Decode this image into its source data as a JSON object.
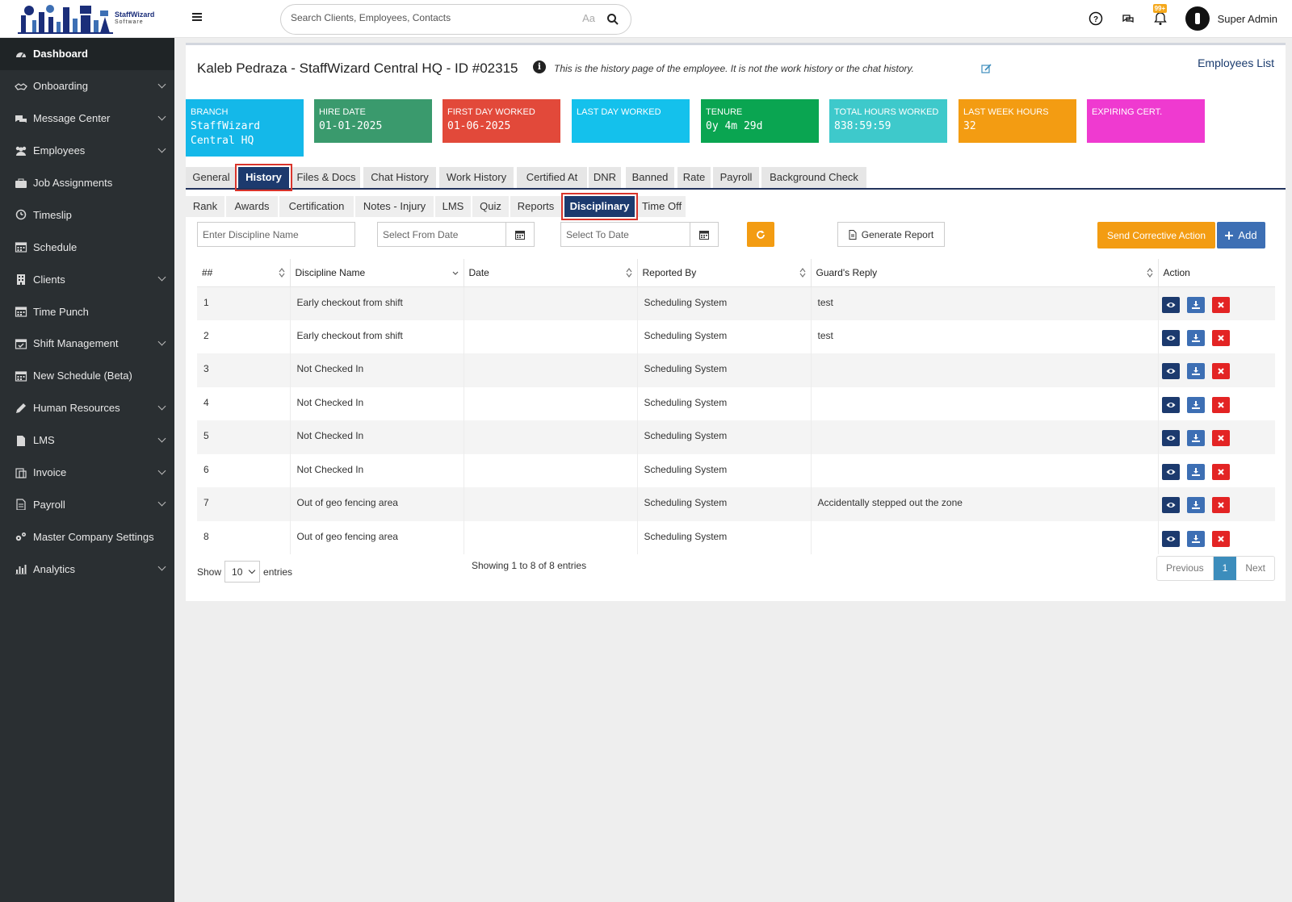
{
  "app": {
    "logo_text": "StaffWizard",
    "logo_sub": "Software",
    "search_placeholder": "Search Clients, Employees, Contacts",
    "search_aa": "Aa",
    "notification_badge": "99+",
    "username": "Super Admin"
  },
  "sidebar": {
    "items": [
      {
        "label": "Dashboard",
        "icon": "dashboard-icon",
        "has_submenu": false
      },
      {
        "label": "Onboarding",
        "icon": "handshake-icon",
        "has_submenu": true
      },
      {
        "label": "Message Center",
        "icon": "chat-icon",
        "has_submenu": true
      },
      {
        "label": "Employees",
        "icon": "users-icon",
        "has_submenu": true
      },
      {
        "label": "Job Assignments",
        "icon": "briefcase-icon",
        "has_submenu": false
      },
      {
        "label": "Timeslip",
        "icon": "clock-icon",
        "has_submenu": false
      },
      {
        "label": "Schedule",
        "icon": "calendar-icon",
        "has_submenu": false
      },
      {
        "label": "Clients",
        "icon": "building-icon",
        "has_submenu": true
      },
      {
        "label": "Time Punch",
        "icon": "calendar-icon",
        "has_submenu": false
      },
      {
        "label": "Shift Management",
        "icon": "calendar-check-icon",
        "has_submenu": true
      },
      {
        "label": "New Schedule (Beta)",
        "icon": "calendar-icon",
        "has_submenu": false
      },
      {
        "label": "Human Resources",
        "icon": "pencil-icon",
        "has_submenu": true
      },
      {
        "label": "LMS",
        "icon": "file-icon",
        "has_submenu": true
      },
      {
        "label": "Invoice",
        "icon": "invoice-icon",
        "has_submenu": true
      },
      {
        "label": "Payroll",
        "icon": "document-icon",
        "has_submenu": true
      },
      {
        "label": "Master Company Settings",
        "icon": "gears-icon",
        "has_submenu": false
      },
      {
        "label": "Analytics",
        "icon": "bar-chart-icon",
        "has_submenu": true
      }
    ]
  },
  "header": {
    "title": "Kaleb Pedraza - StaffWizard Central HQ - ID #02315",
    "info_text": "This is the history page of the employee. It is not the work history or the chat history.",
    "employees_list_link": "Employees List"
  },
  "cards": [
    {
      "label": "BRANCH",
      "value": "StaffWizard Central HQ",
      "color": "#14b8e9"
    },
    {
      "label": "HIRE DATE",
      "value": "01-01-2025",
      "color": "#3a9a6d"
    },
    {
      "label": "FIRST DAY WORKED",
      "value": "01-06-2025",
      "color": "#e2493a"
    },
    {
      "label": "LAST DAY WORKED",
      "value": "",
      "color": "#14c1ec"
    },
    {
      "label": "TENURE",
      "value": "0y 4m 29d",
      "color": "#0aa551"
    },
    {
      "label": "TOTAL HOURS WORKED",
      "value": "838:59:59",
      "color": "#3ec9cb"
    },
    {
      "label": "LAST WEEK HOURS",
      "value": "32",
      "color": "#f39c12"
    },
    {
      "label": "EXPIRING CERT.",
      "value": "",
      "color": "#ef3ad0"
    }
  ],
  "tabs": [
    "General",
    "History",
    "Files & Docs",
    "Chat History",
    "Work History",
    "Certified At",
    "DNR",
    "Banned",
    "Rate",
    "Payroll",
    "Background Check"
  ],
  "active_tab": "History",
  "subtabs": [
    "Rank",
    "Awards",
    "Certification",
    "Notes - Injury",
    "LMS",
    "Quiz",
    "Reports",
    "Disciplinary",
    "Time Off"
  ],
  "active_subtab": "Disciplinary",
  "filters": {
    "discipline_placeholder": "Enter Discipline Name",
    "from_date_placeholder": "Select From Date",
    "to_date_placeholder": "Select To Date",
    "generate_report": "Generate Report",
    "send_corrective": "Send Corrective Action",
    "add": "Add"
  },
  "table": {
    "columns": [
      "##",
      "Discipline Name",
      "Date",
      "Reported By",
      "Guard's Reply",
      "Action"
    ],
    "rows": [
      {
        "num": "1",
        "name": "Early checkout from shift",
        "date": "",
        "reported_by": "Scheduling System",
        "reply": "test"
      },
      {
        "num": "2",
        "name": "Early checkout from shift",
        "date": "",
        "reported_by": "Scheduling System",
        "reply": "test"
      },
      {
        "num": "3",
        "name": "Not Checked In",
        "date": "",
        "reported_by": "Scheduling System",
        "reply": ""
      },
      {
        "num": "4",
        "name": "Not Checked In",
        "date": "",
        "reported_by": "Scheduling System",
        "reply": ""
      },
      {
        "num": "5",
        "name": "Not Checked In",
        "date": "",
        "reported_by": "Scheduling System",
        "reply": ""
      },
      {
        "num": "6",
        "name": "Not Checked In",
        "date": "",
        "reported_by": "Scheduling System",
        "reply": ""
      },
      {
        "num": "7",
        "name": "Out of geo fencing area",
        "date": "",
        "reported_by": "Scheduling System",
        "reply": "Accidentally stepped out the zone"
      },
      {
        "num": "8",
        "name": "Out of geo fencing area",
        "date": "",
        "reported_by": "Scheduling System",
        "reply": ""
      }
    ]
  },
  "pagination": {
    "show_label": "Show",
    "page_size": "10",
    "entries_label": "entries",
    "showing_text": "Showing 1 to 8 of 8 entries",
    "previous": "Previous",
    "current_page": "1",
    "next": "Next"
  }
}
